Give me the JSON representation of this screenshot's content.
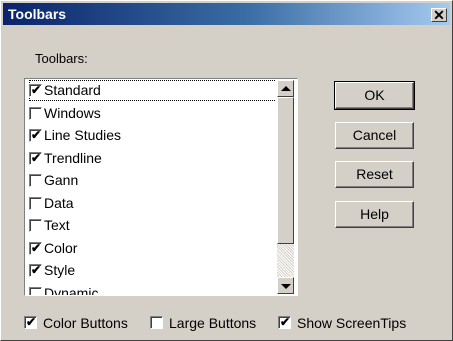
{
  "window": {
    "title": "Toolbars",
    "close_glyph": "✕"
  },
  "toolbars_label": "Toolbars:",
  "toolbar_list": [
    {
      "label": "Standard",
      "checked": true,
      "focused": true
    },
    {
      "label": "Windows",
      "checked": false
    },
    {
      "label": "Line Studies",
      "checked": true
    },
    {
      "label": "Trendline",
      "checked": true
    },
    {
      "label": "Gann",
      "checked": false
    },
    {
      "label": "Data",
      "checked": false
    },
    {
      "label": "Text",
      "checked": false
    },
    {
      "label": "Color",
      "checked": true
    },
    {
      "label": "Style",
      "checked": true
    },
    {
      "label": "Dynamic",
      "checked": false
    }
  ],
  "buttons": {
    "ok": "OK",
    "cancel": "Cancel",
    "reset": "Reset",
    "help": "Help"
  },
  "options": [
    {
      "label": "Color Buttons",
      "checked": true
    },
    {
      "label": "Large Buttons",
      "checked": false
    },
    {
      "label": "Show ScreenTips",
      "checked": true
    }
  ],
  "check_glyph": "✔",
  "icons": {
    "close": "close-icon",
    "scroll_up": "up-arrow-icon",
    "scroll_down": "down-arrow-icon"
  }
}
